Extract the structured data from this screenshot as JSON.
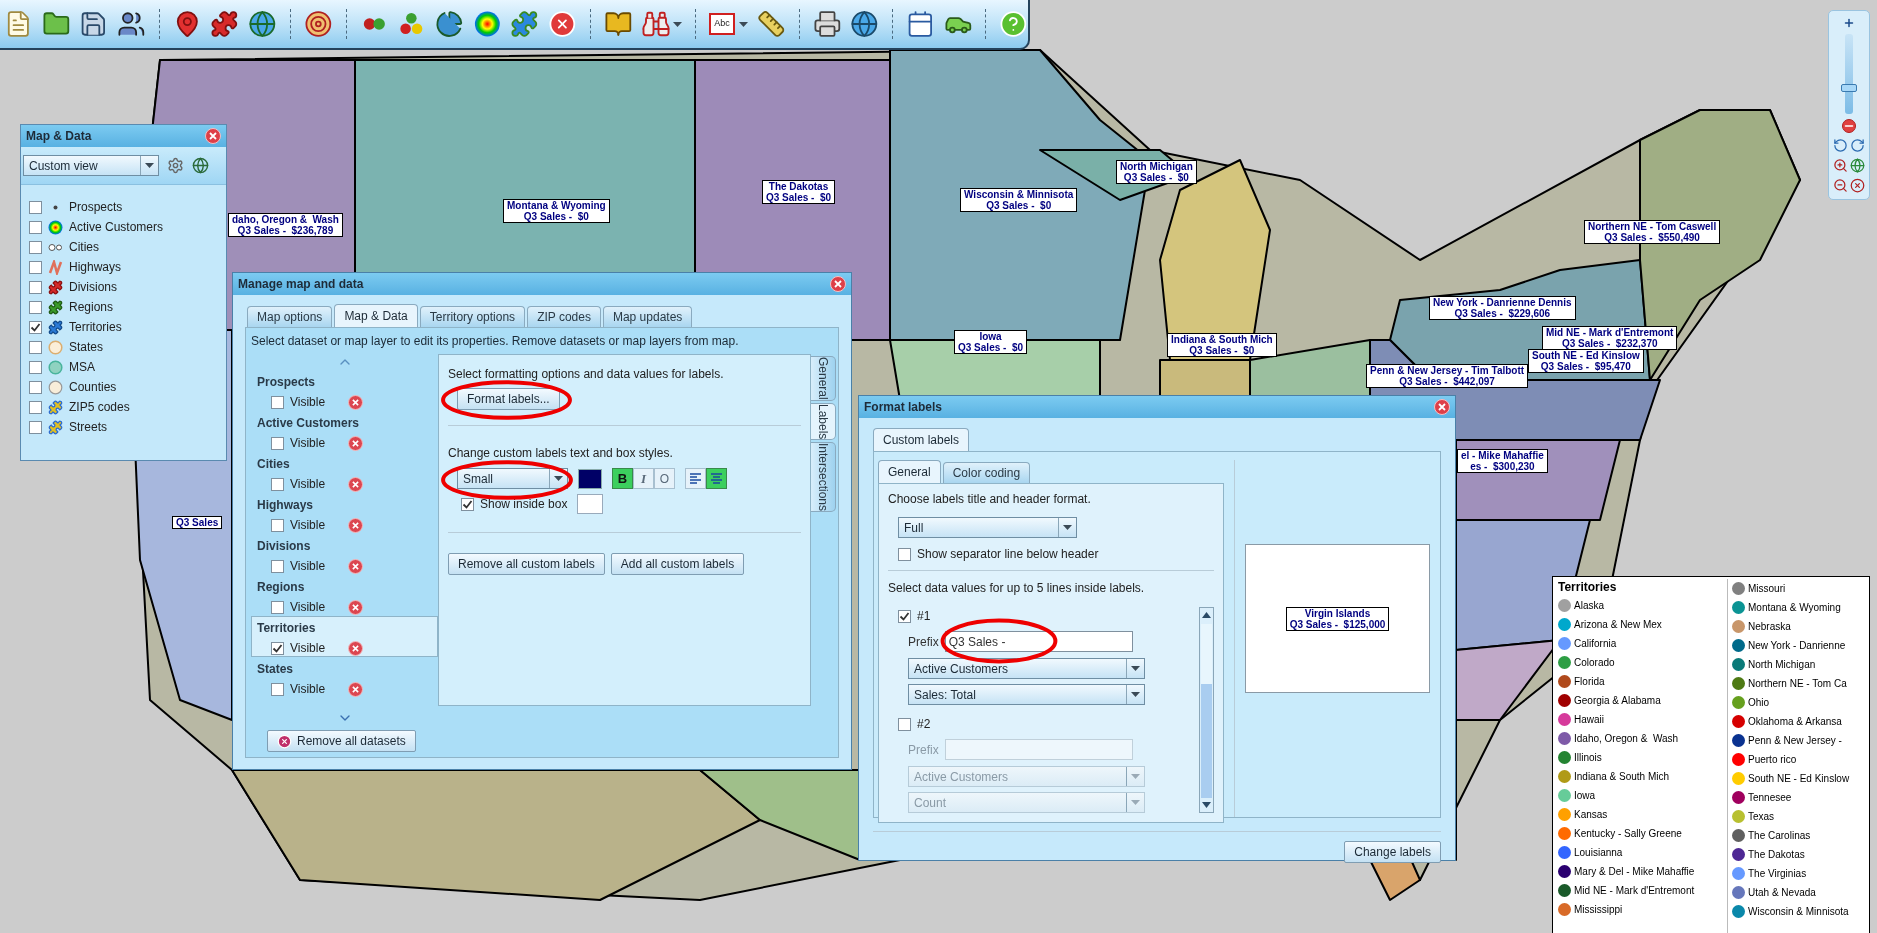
{
  "toolbar": {
    "text_tool_label": "Abc"
  },
  "zoom_control": {
    "level": 0.3
  },
  "map_labels": [
    {
      "lines": [
        "daho, Oregon &  Wash",
        "Q3 Sales -  $236,789"
      ]
    },
    {
      "lines": [
        "Montana & Wyoming",
        "Q3 Sales -  $0"
      ]
    },
    {
      "lines": [
        "The Dakotas",
        "Q3 Sales -  $0"
      ]
    },
    {
      "lines": [
        "Wisconsin & Minnisota",
        "Q3 Sales -  $0"
      ]
    },
    {
      "lines": [
        "North Michigan",
        "Q3 Sales -  $0"
      ]
    },
    {
      "lines": [
        "Iowa",
        "Q3 Sales -  $0"
      ]
    },
    {
      "lines": [
        "Indiana & South Mich",
        "Q3 Sales -  $0"
      ]
    },
    {
      "lines": [
        "Northern NE - Tom Caswell",
        "Q3 Sales -  $550,490"
      ]
    },
    {
      "lines": [
        "New York - Danrienne Dennis",
        "Q3 Sales -  $229,606"
      ]
    },
    {
      "lines": [
        "Mid NE - Mark d'Entremont",
        "Q3 Sales -  $232,370"
      ]
    },
    {
      "lines": [
        "South NE - Ed Kinslow",
        "Q3 Sales -  $95,470"
      ]
    },
    {
      "lines": [
        "Penn & New Jersey - Tim Talbott",
        "Q3 Sales -  $442,097"
      ]
    },
    {
      "lines": [
        "el - Mike Mahaffie",
        "es -  $300,230"
      ]
    },
    {
      "lines": [
        "Q3 Sales"
      ]
    }
  ],
  "map_data_panel": {
    "title": "Map & Data",
    "view": "Custom view",
    "layers": [
      {
        "name": "Prospects",
        "checked": false
      },
      {
        "name": "Active Customers",
        "checked": false
      },
      {
        "name": "Cities",
        "checked": false
      },
      {
        "name": "Highways",
        "checked": false
      },
      {
        "name": "Divisions",
        "checked": false
      },
      {
        "name": "Regions",
        "checked": false
      },
      {
        "name": "Territories",
        "checked": true
      },
      {
        "name": "States",
        "checked": false
      },
      {
        "name": "MSA",
        "checked": false
      },
      {
        "name": "Counties",
        "checked": false
      },
      {
        "name": "ZIP5 codes",
        "checked": false
      },
      {
        "name": "Streets",
        "checked": false
      }
    ]
  },
  "manage_dialog": {
    "title": "Manage map and data",
    "tabs": [
      {
        "label": "Map options",
        "selected": false
      },
      {
        "label": "Map & Data",
        "selected": true
      },
      {
        "label": "Territory options",
        "selected": false
      },
      {
        "label": "ZIP codes",
        "selected": false
      },
      {
        "label": "Map updates",
        "selected": false
      }
    ],
    "instruction": "Select dataset or map layer to edit its properties. Remove datasets or map layers from map.",
    "datasets": [
      {
        "name": "Prospects",
        "visible_label": "Visible",
        "checked": false,
        "selected": false
      },
      {
        "name": "Active Customers",
        "visible_label": "Visible",
        "checked": false,
        "selected": false
      },
      {
        "name": "Cities",
        "visible_label": "Visible",
        "checked": false,
        "selected": false
      },
      {
        "name": "Highways",
        "visible_label": "Visible",
        "checked": false,
        "selected": false
      },
      {
        "name": "Divisions",
        "visible_label": "Visible",
        "checked": false,
        "selected": false
      },
      {
        "name": "Regions",
        "visible_label": "Visible",
        "checked": false,
        "selected": false
      },
      {
        "name": "Territories",
        "visible_label": "Visible",
        "checked": true,
        "selected": true
      },
      {
        "name": "States",
        "visible_label": "Visible",
        "checked": false,
        "selected": false
      }
    ],
    "remove_all": "Remove all datasets",
    "labels_pane": {
      "format_heading": "Select formatting options and data values for labels.",
      "format_button": "Format labels...",
      "style_heading": "Change custom labels text and box styles.",
      "size": "Small",
      "style_buttons": [
        {
          "kind": "bold",
          "label": "B",
          "on": true
        },
        {
          "kind": "italic",
          "label": "I",
          "on": false
        },
        {
          "kind": "outline",
          "label": "O",
          "on": false
        }
      ],
      "align_left": false,
      "align_center": true,
      "show_inside_box": {
        "label": "Show inside box",
        "checked": true
      },
      "remove_button": "Remove all custom labels",
      "add_button": "Add all custom labels"
    },
    "side_tabs": [
      {
        "label": "General",
        "selected": false
      },
      {
        "label": "Labels",
        "selected": true
      },
      {
        "label": "Intersections",
        "selected": false
      }
    ]
  },
  "format_dialog": {
    "title": "Format labels",
    "outer_tabs": [
      {
        "label": "Custom labels",
        "selected": true
      }
    ],
    "inner_tabs": [
      {
        "label": "General",
        "selected": true
      },
      {
        "label": "Color coding",
        "selected": false
      }
    ],
    "header_heading": "Choose labels title and header format.",
    "header_format": "Full",
    "separator": {
      "label": "Show separator line below header",
      "checked": false
    },
    "lines_heading": "Select data values for up to 5 lines inside labels.",
    "lines": [
      {
        "number": "#1",
        "checked": true,
        "prefix_label": "Prefix",
        "prefix": "Q3 Sales -",
        "dataset": "Active Customers",
        "field": "Sales: Total"
      },
      {
        "number": "#2",
        "checked": false,
        "prefix_label": "Prefix",
        "dataset": "Active Customers",
        "field": "Count"
      }
    ],
    "preview": {
      "lines": [
        "Virgin Islands",
        "Q3 Sales -  $125,000"
      ]
    },
    "apply_button": "Change labels"
  },
  "legend": {
    "title": "Territories",
    "columns": [
      [
        {
          "name": "Alaska",
          "color": "#a0a0a0"
        },
        {
          "name": "Arizona & New Mex",
          "color": "#00a8cc"
        },
        {
          "name": "California",
          "color": "#6699ff"
        },
        {
          "name": "Colorado",
          "color": "#2e9e44"
        },
        {
          "name": "Florida",
          "color": "#b04a1c"
        },
        {
          "name": "Georgia & Alabama",
          "color": "#a00000"
        },
        {
          "name": "Hawaii",
          "color": "#d63a9b"
        },
        {
          "name": "Idaho, Oregon &  Wash",
          "color": "#7e5aa8"
        },
        {
          "name": "Illinois",
          "color": "#248432"
        },
        {
          "name": "Indiana & South Mich",
          "color": "#b09a17"
        },
        {
          "name": "Iowa",
          "color": "#66cc99"
        },
        {
          "name": "Kansas",
          "color": "#ffa000"
        },
        {
          "name": "Kentucky - Sally Greene",
          "color": "#ff6a00"
        },
        {
          "name": "Louisianna",
          "color": "#3366ff"
        },
        {
          "name": "Mary & Del - Mike Mahaffie",
          "color": "#2a0070"
        },
        {
          "name": "Mid NE - Mark d'Entremont",
          "color": "#1a5a2a"
        },
        {
          "name": "Mississippi",
          "color": "#d86a28"
        }
      ],
      [
        {
          "name": "Missouri",
          "color": "#808080"
        },
        {
          "name": "Montana & Wyoming",
          "color": "#0b9494"
        },
        {
          "name": "Nebraska",
          "color": "#c8966a"
        },
        {
          "name": "New York - Danrienne",
          "color": "#006a8a"
        },
        {
          "name": "North Michigan",
          "color": "#0a7a78"
        },
        {
          "name": "Northern NE - Tom Ca",
          "color": "#4e7a14"
        },
        {
          "name": "Ohio",
          "color": "#66a01e"
        },
        {
          "name": "Oklahoma & Arkansa",
          "color": "#d60000"
        },
        {
          "name": "Penn & New Jersey -",
          "color": "#0a3290"
        },
        {
          "name": "Puerto rico",
          "color": "#ff0000"
        },
        {
          "name": "South NE - Ed Kinslow",
          "color": "#ffcc00"
        },
        {
          "name": "Tennesee",
          "color": "#a0005e"
        },
        {
          "name": "Texas",
          "color": "#b8c030"
        },
        {
          "name": "The Carolinas",
          "color": "#606060"
        },
        {
          "name": "The Dakotas",
          "color": "#4e2894"
        },
        {
          "name": "The Virginias",
          "color": "#6699ff"
        },
        {
          "name": "Utah & Nevada",
          "color": "#6677bb"
        },
        {
          "name": "Wisconsin & Minnisota",
          "color": "#0a88aa"
        }
      ]
    ]
  }
}
